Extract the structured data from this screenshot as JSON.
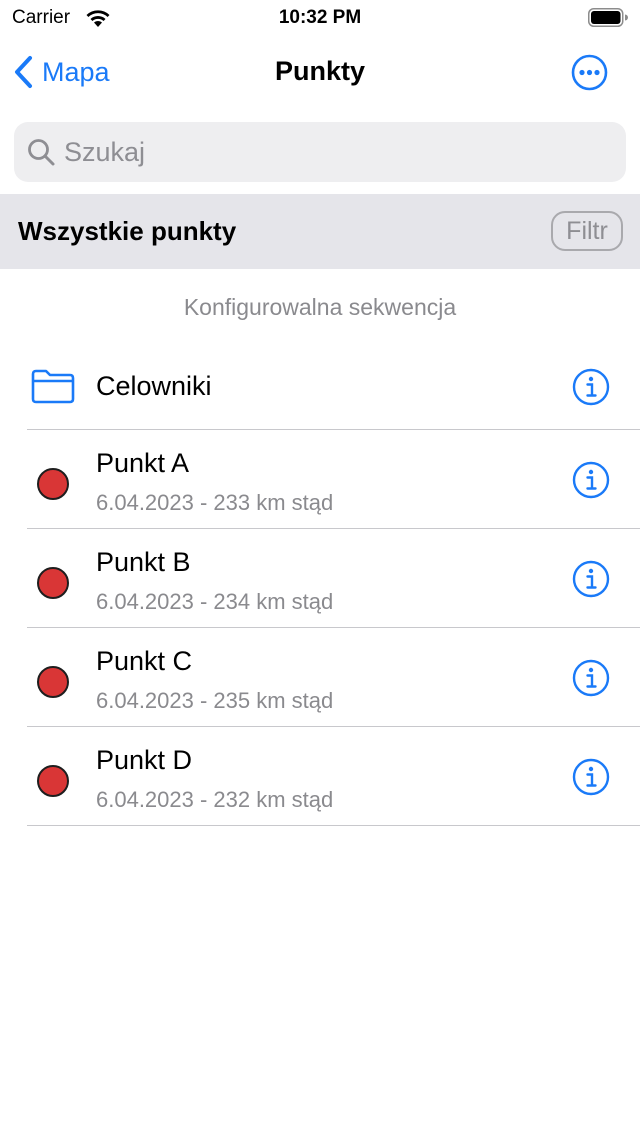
{
  "status_bar": {
    "carrier": "Carrier",
    "time": "10:32 PM"
  },
  "nav": {
    "back_label": "Mapa",
    "title": "Punkty",
    "more_icon": "ellipsis-circle-icon"
  },
  "search": {
    "placeholder": "Szukaj",
    "value": ""
  },
  "section": {
    "title": "Wszystkie punkty",
    "filter_label": "Filtr"
  },
  "list": {
    "caption": "Konfigurowalna sekwencja",
    "folder": {
      "name": "Celowniki",
      "icon": "folder-icon"
    },
    "points": [
      {
        "name": "Punkt A",
        "subtitle": "6.04.2023 - 233 km stąd"
      },
      {
        "name": "Punkt B",
        "subtitle": "6.04.2023 - 234 km stąd"
      },
      {
        "name": "Punkt C",
        "subtitle": "6.04.2023 - 235 km stąd"
      },
      {
        "name": "Punkt D",
        "subtitle": "6.04.2023 - 232 km stąd"
      }
    ]
  },
  "colors": {
    "accent": "#1a7af8",
    "point_marker": "#d93636",
    "secondary_text": "#8a8a8e"
  }
}
